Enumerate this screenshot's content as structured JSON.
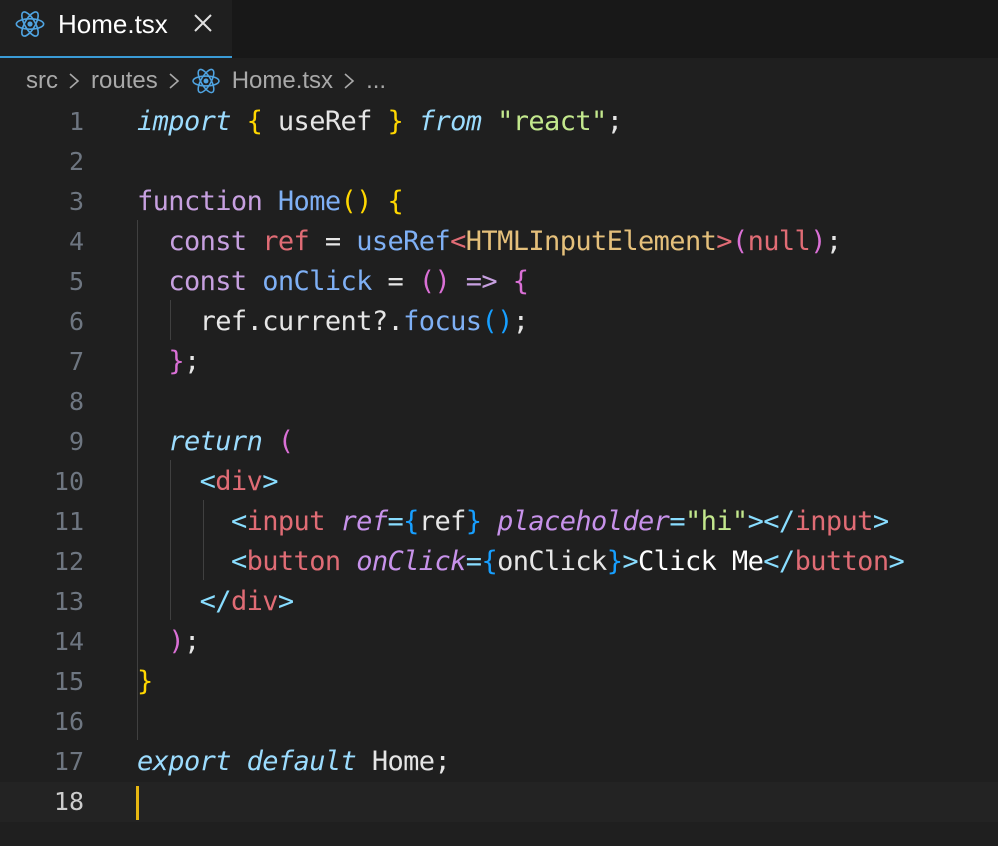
{
  "tab": {
    "title": "Home.tsx",
    "close_icon": "close-icon",
    "file_icon": "react-icon"
  },
  "breadcrumb": {
    "items": [
      "src",
      "routes",
      "Home.tsx",
      "..."
    ]
  },
  "editor": {
    "current_line": "18",
    "line_numbers": [
      "1",
      "2",
      "3",
      "4",
      "5",
      "6",
      "7",
      "8",
      "9",
      "10",
      "11",
      "12",
      "13",
      "14",
      "15",
      "16",
      "17",
      "18"
    ],
    "lines": [
      [
        {
          "t": "import",
          "c": "kw-it"
        },
        {
          "t": " "
        },
        {
          "t": "{",
          "c": "br1"
        },
        {
          "t": " useRef ",
          "c": "id"
        },
        {
          "t": "}",
          "c": "br1"
        },
        {
          "t": " "
        },
        {
          "t": "from",
          "c": "kw-it"
        },
        {
          "t": " "
        },
        {
          "t": "\"react\"",
          "c": "str"
        },
        {
          "t": ";",
          "c": "id"
        }
      ],
      [],
      [
        {
          "t": "function",
          "c": "kw-blue"
        },
        {
          "t": " "
        },
        {
          "t": "Home",
          "c": "fn"
        },
        {
          "t": "()",
          "c": "br1"
        },
        {
          "t": " "
        },
        {
          "t": "{",
          "c": "br1"
        }
      ],
      [
        {
          "t": "  "
        },
        {
          "t": "const",
          "c": "kw-blue"
        },
        {
          "t": " "
        },
        {
          "t": "ref",
          "c": "var"
        },
        {
          "t": " = ",
          "c": "id"
        },
        {
          "t": "useRef",
          "c": "fn"
        },
        {
          "t": "<",
          "c": "tag"
        },
        {
          "t": "HTMLInputElement",
          "c": "type"
        },
        {
          "t": ">",
          "c": "tag"
        },
        {
          "t": "(",
          "c": "br2"
        },
        {
          "t": "null",
          "c": "tag"
        },
        {
          "t": ")",
          "c": "br2"
        },
        {
          "t": ";",
          "c": "id"
        }
      ],
      [
        {
          "t": "  "
        },
        {
          "t": "const",
          "c": "kw-blue"
        },
        {
          "t": " "
        },
        {
          "t": "onClick",
          "c": "fn"
        },
        {
          "t": " = ",
          "c": "id"
        },
        {
          "t": "()",
          "c": "br2"
        },
        {
          "t": " "
        },
        {
          "t": "=>",
          "c": "kw-blue"
        },
        {
          "t": " "
        },
        {
          "t": "{",
          "c": "br2"
        }
      ],
      [
        {
          "t": "    "
        },
        {
          "t": "ref.current?.",
          "c": "id"
        },
        {
          "t": "focus",
          "c": "fn"
        },
        {
          "t": "()",
          "c": "br3"
        },
        {
          "t": ";",
          "c": "id"
        }
      ],
      [
        {
          "t": "  "
        },
        {
          "t": "}",
          "c": "br2"
        },
        {
          "t": ";",
          "c": "id"
        }
      ],
      [],
      [
        {
          "t": "  "
        },
        {
          "t": "return",
          "c": "kw-it"
        },
        {
          "t": " "
        },
        {
          "t": "(",
          "c": "br2"
        }
      ],
      [
        {
          "t": "    "
        },
        {
          "t": "<",
          "c": "tagp"
        },
        {
          "t": "div",
          "c": "tag"
        },
        {
          "t": ">",
          "c": "tagp"
        }
      ],
      [
        {
          "t": "      "
        },
        {
          "t": "<",
          "c": "tagp"
        },
        {
          "t": "input",
          "c": "tag"
        },
        {
          "t": " "
        },
        {
          "t": "ref",
          "c": "attr"
        },
        {
          "t": "=",
          "c": "tagp"
        },
        {
          "t": "{",
          "c": "br3"
        },
        {
          "t": "ref",
          "c": "id"
        },
        {
          "t": "}",
          "c": "br3"
        },
        {
          "t": " "
        },
        {
          "t": "placeholder",
          "c": "attr"
        },
        {
          "t": "=",
          "c": "tagp"
        },
        {
          "t": "\"hi\"",
          "c": "str"
        },
        {
          "t": "></",
          "c": "tagp"
        },
        {
          "t": "input",
          "c": "tag"
        },
        {
          "t": ">",
          "c": "tagp"
        }
      ],
      [
        {
          "t": "      "
        },
        {
          "t": "<",
          "c": "tagp"
        },
        {
          "t": "button",
          "c": "tag"
        },
        {
          "t": " "
        },
        {
          "t": "onClick",
          "c": "attr"
        },
        {
          "t": "=",
          "c": "tagp"
        },
        {
          "t": "{",
          "c": "br3"
        },
        {
          "t": "onClick",
          "c": "id"
        },
        {
          "t": "}",
          "c": "br3"
        },
        {
          "t": ">",
          "c": "tagp"
        },
        {
          "t": "Click Me",
          "c": "text"
        },
        {
          "t": "</",
          "c": "tagp"
        },
        {
          "t": "button",
          "c": "tag"
        },
        {
          "t": ">",
          "c": "tagp"
        }
      ],
      [
        {
          "t": "    "
        },
        {
          "t": "</",
          "c": "tagp"
        },
        {
          "t": "div",
          "c": "tag"
        },
        {
          "t": ">",
          "c": "tagp"
        }
      ],
      [
        {
          "t": "  "
        },
        {
          "t": ")",
          "c": "br2"
        },
        {
          "t": ";",
          "c": "id"
        }
      ],
      [
        {
          "t": "}",
          "c": "br1"
        }
      ],
      [],
      [
        {
          "t": "export",
          "c": "kw-it"
        },
        {
          "t": " "
        },
        {
          "t": "default",
          "c": "kw-it"
        },
        {
          "t": " "
        },
        {
          "t": "Home",
          "c": "id"
        },
        {
          "t": ";",
          "c": "id"
        }
      ],
      []
    ]
  },
  "colors": {
    "background": "#1f1f1f",
    "tab_accent": "#3a9bd6",
    "cursor": "#e7b711",
    "react_icon": "#4fa3e0"
  }
}
